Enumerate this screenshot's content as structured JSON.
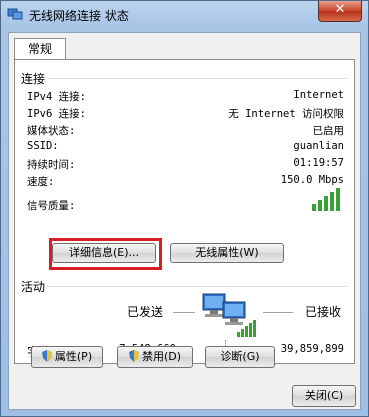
{
  "window": {
    "title": "无线网络连接 状态",
    "close_label": "✕"
  },
  "tab": {
    "label": "常规"
  },
  "connection": {
    "section_label": "连接",
    "rows": [
      {
        "label": "IPv4 连接:",
        "value": "Internet"
      },
      {
        "label": "IPv6 连接:",
        "value": "无 Internet 访问权限"
      },
      {
        "label": "媒体状态:",
        "value": "已启用"
      },
      {
        "label": "SSID:",
        "value": "guanlian"
      },
      {
        "label": "持续时间:",
        "value": "01:19:57"
      },
      {
        "label": "速度:",
        "value": "150.0 Mbps"
      }
    ],
    "signal_label": "信号质量:",
    "signal_bars": 5,
    "details_button": "详细信息(E)...",
    "wireless_props_button": "无线属性(W)"
  },
  "activity": {
    "section_label": "活动",
    "sent_label": "已发送",
    "received_label": "已接收",
    "bytes_label": "字节:",
    "bytes_sent": "7,548,660",
    "bytes_received": "39,859,899"
  },
  "buttons": {
    "properties": "属性(P)",
    "disable": "禁用(D)",
    "diagnose": "诊断(G)"
  },
  "footer": {
    "close": "关闭(C)"
  },
  "colors": {
    "signal_green": "#3aa13a",
    "highlight_red": "#d81f26"
  }
}
